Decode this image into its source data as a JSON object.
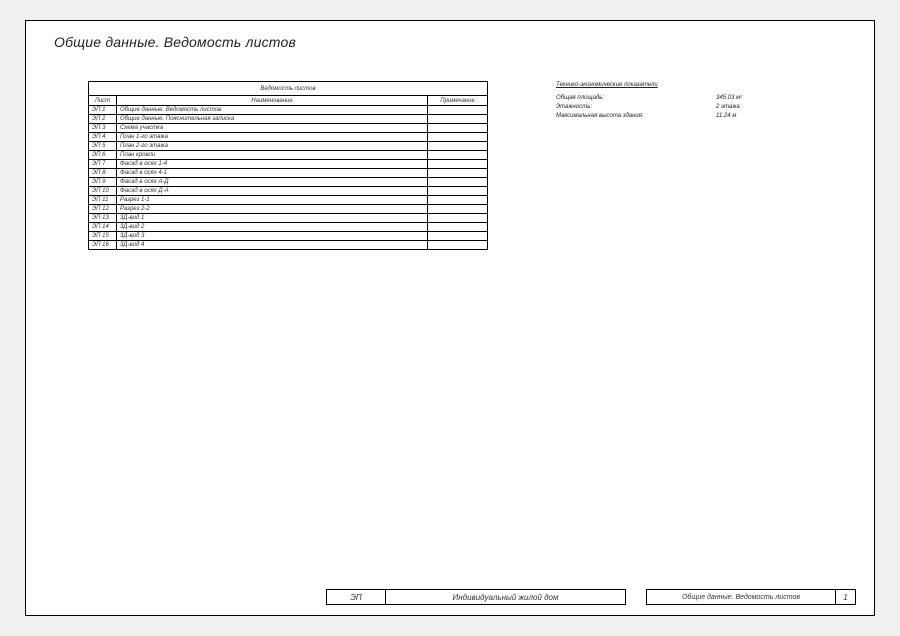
{
  "page_title": "Общие данные. Ведомость листов",
  "table": {
    "title": "Ведомость листов",
    "headers": {
      "num": "Лист",
      "name": "Наименование",
      "note": "Примечание"
    },
    "rows": [
      {
        "num": "ЭП 1",
        "name": "Общие данные. Ведомость листов",
        "note": ""
      },
      {
        "num": "ЭП 2",
        "name": "Общие данные. Пояснительная записка",
        "note": ""
      },
      {
        "num": "ЭП 3",
        "name": "Схема участка",
        "note": ""
      },
      {
        "num": "ЭП 4",
        "name": "План 1-го этажа",
        "note": ""
      },
      {
        "num": "ЭП 5",
        "name": "План 2-го этажа",
        "note": ""
      },
      {
        "num": "ЭП 6",
        "name": "План кровли",
        "note": ""
      },
      {
        "num": "ЭП 7",
        "name": "Фасад в осях 1-4",
        "note": ""
      },
      {
        "num": "ЭП 8",
        "name": "Фасад в осях 4-1",
        "note": ""
      },
      {
        "num": "ЭП 9",
        "name": "Фасад в осях А-Д",
        "note": ""
      },
      {
        "num": "ЭП 10",
        "name": "Фасад в осях Д-А",
        "note": ""
      },
      {
        "num": "ЭП 11",
        "name": "Разрез 1-1",
        "note": ""
      },
      {
        "num": "ЭП 12",
        "name": "Разрез 2-2",
        "note": ""
      },
      {
        "num": "ЭП 13",
        "name": "3Д-вид 1",
        "note": ""
      },
      {
        "num": "ЭП 14",
        "name": "3Д-вид 2",
        "note": ""
      },
      {
        "num": "ЭП 15",
        "name": "3Д-вид 3",
        "note": ""
      },
      {
        "num": "ЭП 16",
        "name": "3Д-вид 4",
        "note": ""
      }
    ]
  },
  "tech": {
    "title": "Технико-экономические показатели",
    "items": [
      {
        "label": "Общая площадь:",
        "value": "345.03 м²"
      },
      {
        "label": "Этажность:",
        "value": "2 этажа"
      },
      {
        "label": "Максимальная высота здания:",
        "value": "11.24 м"
      }
    ]
  },
  "title_block": {
    "code": "ЭП",
    "project": "Индивидуальный жилой дом",
    "sheet_name": "Общие данные. Ведомость листов",
    "page_num": "1"
  }
}
